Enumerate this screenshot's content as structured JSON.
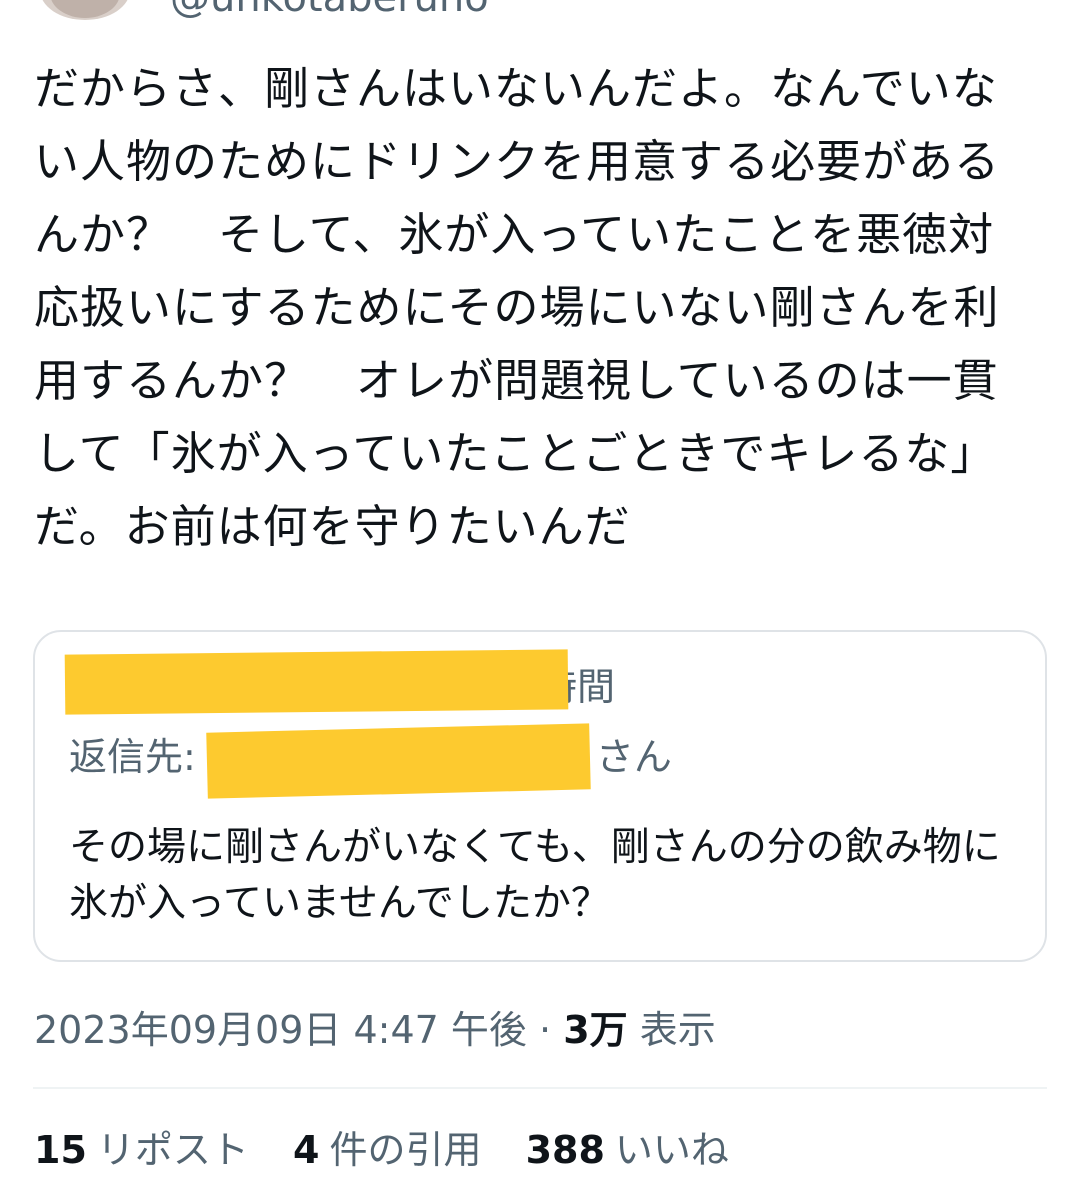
{
  "author": {
    "handle": "@unkotaberuno"
  },
  "tweet": {
    "text": "だからさ、剛さんはいないんだよ。なんでいない人物のためにドリンクを用意する必要があるんか？　そして、氷が入っていたことを悪徳対応扱いにするためにその場にいない剛さんを利用するんか？　オレが問題視しているのは一貫して「氷が入っていたことごときでキレるな」だ。お前は何を守りたいんだ"
  },
  "quote": {
    "header_suffix": "時間",
    "reply_prefix": "返信先:",
    "reply_suffix": "さん",
    "text": "その場に剛さんがいなくても、剛さんの分の飲み物に氷が入っていませんでしたか？"
  },
  "meta": {
    "timestamp": "2023年09月09日 4:47 午後",
    "separator": "·",
    "views_count": "3万",
    "views_label": "表示"
  },
  "stats": {
    "reposts_count": "15",
    "reposts_label": "リポスト",
    "quotes_count": "4",
    "quotes_label": "件の引用",
    "likes_count": "388",
    "likes_label": "いいね"
  },
  "colors": {
    "redaction": "#fdca2f",
    "secondary_text": "#536471",
    "primary_text": "#0f1419"
  }
}
